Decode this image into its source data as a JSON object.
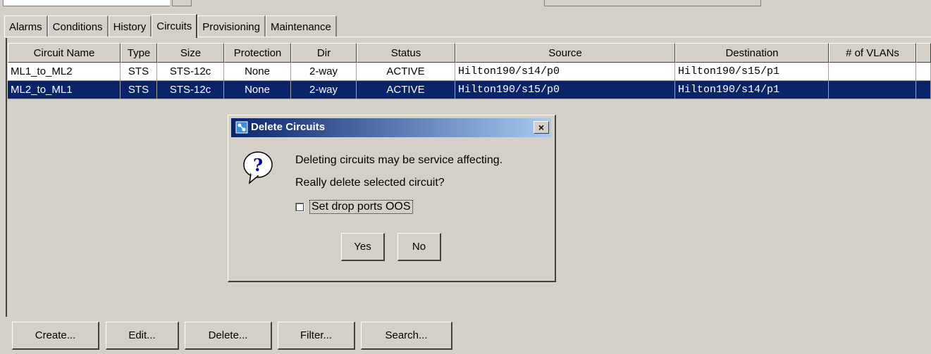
{
  "tabs": [
    "Alarms",
    "Conditions",
    "History",
    "Circuits",
    "Provisioning",
    "Maintenance"
  ],
  "active_tab": "Circuits",
  "table": {
    "columns": [
      "Circuit Name",
      "Type",
      "Size",
      "Protection",
      "Dir",
      "Status",
      "Source",
      "Destination",
      "# of VLANs"
    ],
    "rows": [
      [
        "ML1_to_ML2",
        "STS",
        "STS-12c",
        "None",
        "2-way",
        "ACTIVE",
        "Hilton190/s14/p0",
        "Hilton190/s15/p1",
        ""
      ],
      [
        "ML2_to_ML1",
        "STS",
        "STS-12c",
        "None",
        "2-way",
        "ACTIVE",
        "Hilton190/s15/p0",
        "Hilton190/s14/p1",
        ""
      ]
    ],
    "selected_row": 1
  },
  "dialog": {
    "title": "Delete Circuits",
    "close_label": "×",
    "message_line1": "Deleting circuits may be service affecting.",
    "message_line2": "Really delete selected circuit?",
    "checkbox_label": "Set drop ports OOS",
    "checkbox_checked": false,
    "yes_label": "Yes",
    "no_label": "No",
    "icon": "question-icon"
  },
  "buttons": {
    "create": "Create...",
    "edit": "Edit...",
    "delete": "Delete...",
    "filter": "Filter...",
    "search": "Search..."
  },
  "colors": {
    "selection": "#0a246a",
    "chrome": "#d4d0c8"
  }
}
